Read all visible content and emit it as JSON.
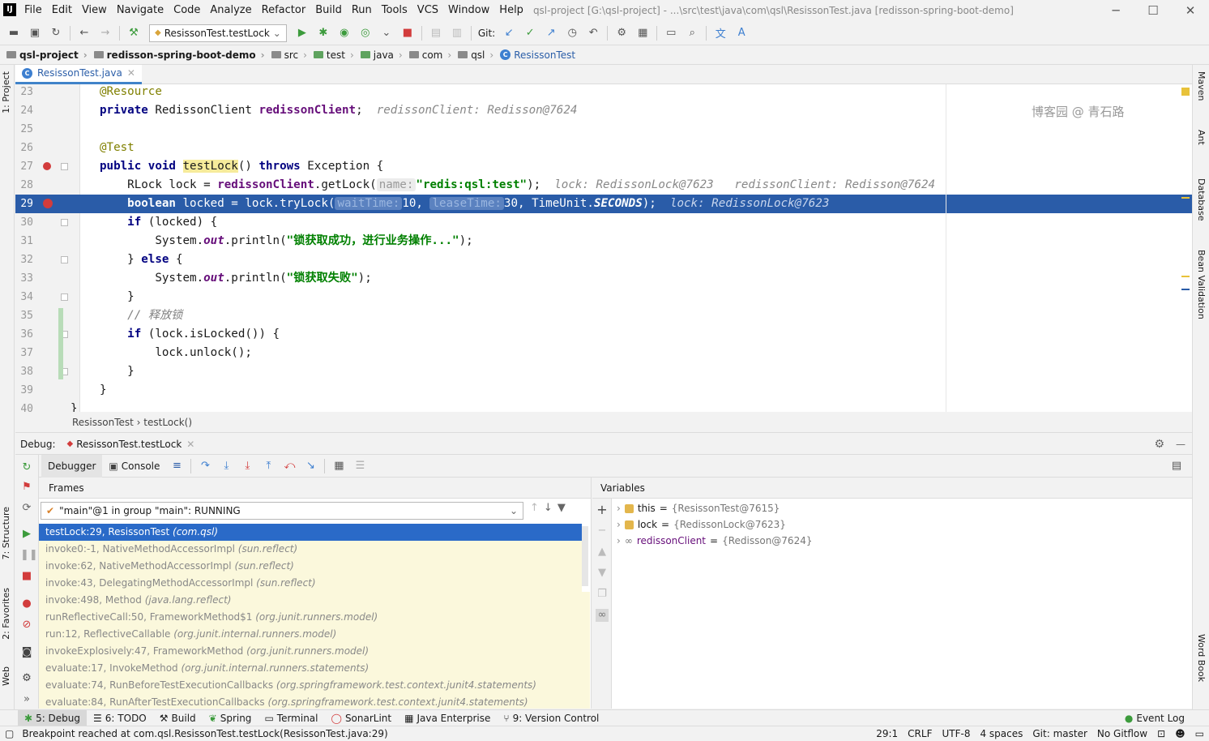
{
  "title_bar": {
    "logo": "IJ",
    "menu": [
      "File",
      "Edit",
      "View",
      "Navigate",
      "Code",
      "Analyze",
      "Refactor",
      "Build",
      "Run",
      "Tools",
      "VCS",
      "Window",
      "Help"
    ],
    "window_title": "qsl-project [G:\\qsl-project] - ...\\src\\test\\java\\com\\qsl\\ResissonTest.java [redisson-spring-boot-demo]",
    "controls": [
      "─",
      "☐",
      "✕"
    ]
  },
  "toolbar": {
    "run_config": "ResissonTest.testLock",
    "git_label": "Git:"
  },
  "nav_bar": {
    "crumbs": [
      "qsl-project",
      "redisson-spring-boot-demo",
      "src",
      "test",
      "java",
      "com",
      "qsl",
      "ResissonTest"
    ]
  },
  "left_stripe": {
    "project": "1: Project",
    "structure": "7: Structure",
    "favorites": "2: Favorites",
    "web": "Web"
  },
  "right_stripe": {
    "maven": "Maven",
    "ant": "Ant",
    "database": "Database",
    "bean_validation": "Bean Validation",
    "word_book": "Word Book"
  },
  "editor": {
    "tab": "ResissonTest.java",
    "watermark": "博客园 @ 青石路",
    "lines": {
      "n23": "23",
      "n24": "24",
      "n25": "25",
      "n26": "26",
      "n27": "27",
      "n28": "28",
      "n29": "29",
      "n30": "30",
      "n31": "31",
      "n32": "32",
      "n33": "33",
      "n34": "34",
      "n35": "35",
      "n36": "36",
      "n37": "37",
      "n38": "38",
      "n39": "39",
      "n40": "40"
    },
    "code": {
      "l23_ann": "@Resource",
      "l24_kw": "private",
      "l24_type": " RedissonClient ",
      "l24_fld": "redissonClient",
      "l24_end": ";",
      "l24_inline": "redissonClient: Redisson@7624",
      "l26_ann": "@Test",
      "l27_kw1": "public void ",
      "l27_name": "testLock",
      "l27_mid": "() ",
      "l27_kw2": "throws",
      "l27_end": " Exception {",
      "l28_a": "RLock lock = ",
      "l28_fld": "redissonClient",
      "l28_b": ".getLock(",
      "l28_hint": "name:",
      "l28_str": "\"redis:qsl:test\"",
      "l28_c": ");",
      "l28_inline": "lock: RedissonLock@7623   redissonClient: Redisson@7624",
      "l29_kw": "boolean",
      "l29_a": " locked = lock.tryLock(",
      "l29_hint1": "waitTime:",
      "l29_b": "10, ",
      "l29_hint2": "leaseTime:",
      "l29_c": "30, TimeUnit.",
      "l29_const": "SECONDS",
      "l29_d": ");",
      "l29_inline": "lock: RedissonLock@7623",
      "l30_kw": "if",
      "l30_a": " (locked) {",
      "l31_a": "System.",
      "l31_out": "out",
      "l31_b": ".println(",
      "l31_str": "\"锁获取成功，进行业务操作...\"",
      "l31_c": ");",
      "l32_a": "} ",
      "l32_kw": "else",
      "l32_b": " {",
      "l33_a": "System.",
      "l33_out": "out",
      "l33_b": ".println(",
      "l33_str": "\"锁获取失败\"",
      "l33_c": ");",
      "l34": "}",
      "l35": "// 释放锁",
      "l36_kw": "if",
      "l36_a": " (lock.isLocked()) {",
      "l37": "lock.unlock();",
      "l38": "}",
      "l39": "}",
      "l40": "}"
    },
    "breadcrumbs": "ResissonTest  ›  testLock()"
  },
  "debug": {
    "label": "Debug:",
    "session_tab": "ResissonTest.testLock",
    "tabs": {
      "debugger": "Debugger",
      "console": "Console"
    },
    "frames_header": "Frames",
    "thread": "\"main\"@1 in group \"main\": RUNNING",
    "frames": [
      {
        "loc": "testLock:29, ResissonTest ",
        "pkg": "(com.qsl)"
      },
      {
        "loc": "invoke0:-1, NativeMethodAccessorImpl ",
        "pkg": "(sun.reflect)"
      },
      {
        "loc": "invoke:62, NativeMethodAccessorImpl ",
        "pkg": "(sun.reflect)"
      },
      {
        "loc": "invoke:43, DelegatingMethodAccessorImpl ",
        "pkg": "(sun.reflect)"
      },
      {
        "loc": "invoke:498, Method ",
        "pkg": "(java.lang.reflect)"
      },
      {
        "loc": "runReflectiveCall:50, FrameworkMethod$1 ",
        "pkg": "(org.junit.runners.model)"
      },
      {
        "loc": "run:12, ReflectiveCallable ",
        "pkg": "(org.junit.internal.runners.model)"
      },
      {
        "loc": "invokeExplosively:47, FrameworkMethod ",
        "pkg": "(org.junit.runners.model)"
      },
      {
        "loc": "evaluate:17, InvokeMethod ",
        "pkg": "(org.junit.internal.runners.statements)"
      },
      {
        "loc": "evaluate:74, RunBeforeTestExecutionCallbacks ",
        "pkg": "(org.springframework.test.context.junit4.statements)"
      },
      {
        "loc": "evaluate:84, RunAfterTestExecutionCallbacks ",
        "pkg": "(org.springframework.test.context.junit4.statements)"
      }
    ],
    "variables_header": "Variables",
    "variables": [
      {
        "name": "this",
        "value": "{ResissonTest@7615}"
      },
      {
        "name": "lock",
        "value": "{RedissonLock@7623}"
      },
      {
        "name": "redissonClient",
        "value": "{Redisson@7624}"
      }
    ],
    "equals": " = "
  },
  "tool_windows": {
    "debug": "5: Debug",
    "todo": "6: TODO",
    "build": "Build",
    "spring": "Spring",
    "terminal": "Terminal",
    "sonarlint": "SonarLint",
    "java_enterprise": "Java Enterprise",
    "version_control": "9: Version Control",
    "event_log": "Event Log"
  },
  "status_bar": {
    "message": "Breakpoint reached at com.qsl.ResissonTest.testLock(ResissonTest.java:29)",
    "position": "29:1",
    "line_sep": "CRLF",
    "encoding": "UTF-8",
    "indent": "4 spaces",
    "git": "Git: master",
    "gitflow": "No Gitflow"
  },
  "colors": {
    "accent": "#2a5ca8",
    "selection": "#2a6ac8",
    "breakpoint": "#d23c3c",
    "run_green": "#3c9b3c",
    "stop_red": "#d23c3c"
  }
}
